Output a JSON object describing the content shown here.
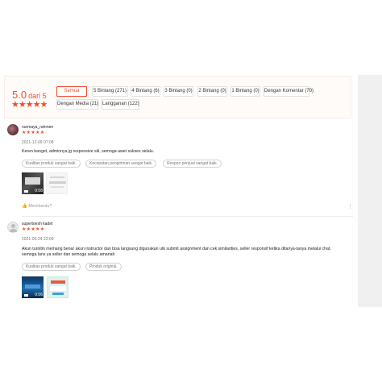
{
  "overview": {
    "score": "5.0",
    "score_suffix": "dari 5",
    "stars": "★★★★★",
    "filters": [
      "Semua",
      "5 Bintang (271)",
      "4 Bintang (6)",
      "3 Bintang (0)",
      "2 Bintang (0)",
      "1 Bintang (0)",
      "Dengan Komentar (70)",
      "Dengan Media (21)",
      "Langganan (122)"
    ],
    "active_filter": "Semua",
    "accent_color": "#ee4d2d"
  },
  "reviews": [
    {
      "username": "nurmaya_rahmen",
      "stars": "★★★★★",
      "date": "2021-12-09 07:08",
      "text": "Keren banget, adminnya jg responsive skl, semoga awet sukses selalu.",
      "tags": [
        "Kualitas produk sangat baik.",
        "Kecepatan pengiriman sangat baik.",
        "Respon penjual sangat baik."
      ],
      "media_duration": "0:08",
      "helpful": "Membantu?"
    },
    {
      "username": "supertoesh kadet",
      "stars": "★★★★★",
      "date": "2021-06-24 23:09",
      "text": "Akun turnitin memang benar akun instructor dan bisa langsung digunakan utk submit assignment dan cek similarities, seller responsif ketika ditanya-tanya melalui chat,",
      "text2": "semoga lanx ya seller dan semoga selalu amanah",
      "tags": [
        "Kualitas produk sangat baik.",
        "Produk original."
      ],
      "media_duration": "0:06"
    }
  ]
}
